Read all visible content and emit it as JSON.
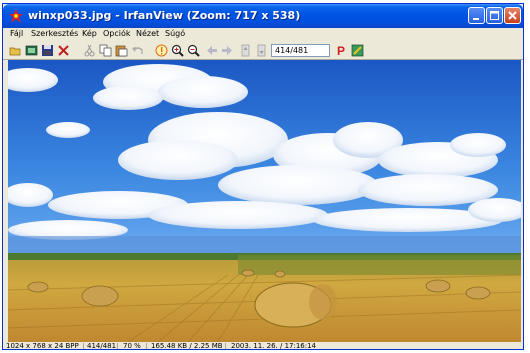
{
  "window": {
    "title": "winxp033.jpg - IrfanView (Zoom: 717 x 538)"
  },
  "menu": {
    "items": [
      "Fájl",
      "Szerkesztés",
      "Kép",
      "Opciók",
      "Nézet",
      "Súgó"
    ]
  },
  "toolbar": {
    "page_field": "414/481",
    "icons": [
      "open-folder-icon",
      "slideshow-icon",
      "save-icon",
      "delete-icon",
      "cut-icon",
      "copy-icon",
      "paste-icon",
      "undo-icon",
      "info-icon",
      "zoom-in-icon",
      "zoom-out-icon",
      "prev-icon",
      "next-icon",
      "first-icon",
      "last-icon",
      "print-icon",
      "paint-icon"
    ]
  },
  "status": {
    "dimensions": "1024 x 768 x 24 BPP",
    "index": "414/481",
    "zoom": "70 %",
    "size": "165.48 KB / 2.25 MB",
    "datetime": "2003. 11. 26. / 17:16:14"
  },
  "colors": {
    "titlebar": "#0054e3",
    "sky": "#2e6ed2",
    "field": "#c9a040",
    "close_button": "#c4401c"
  }
}
